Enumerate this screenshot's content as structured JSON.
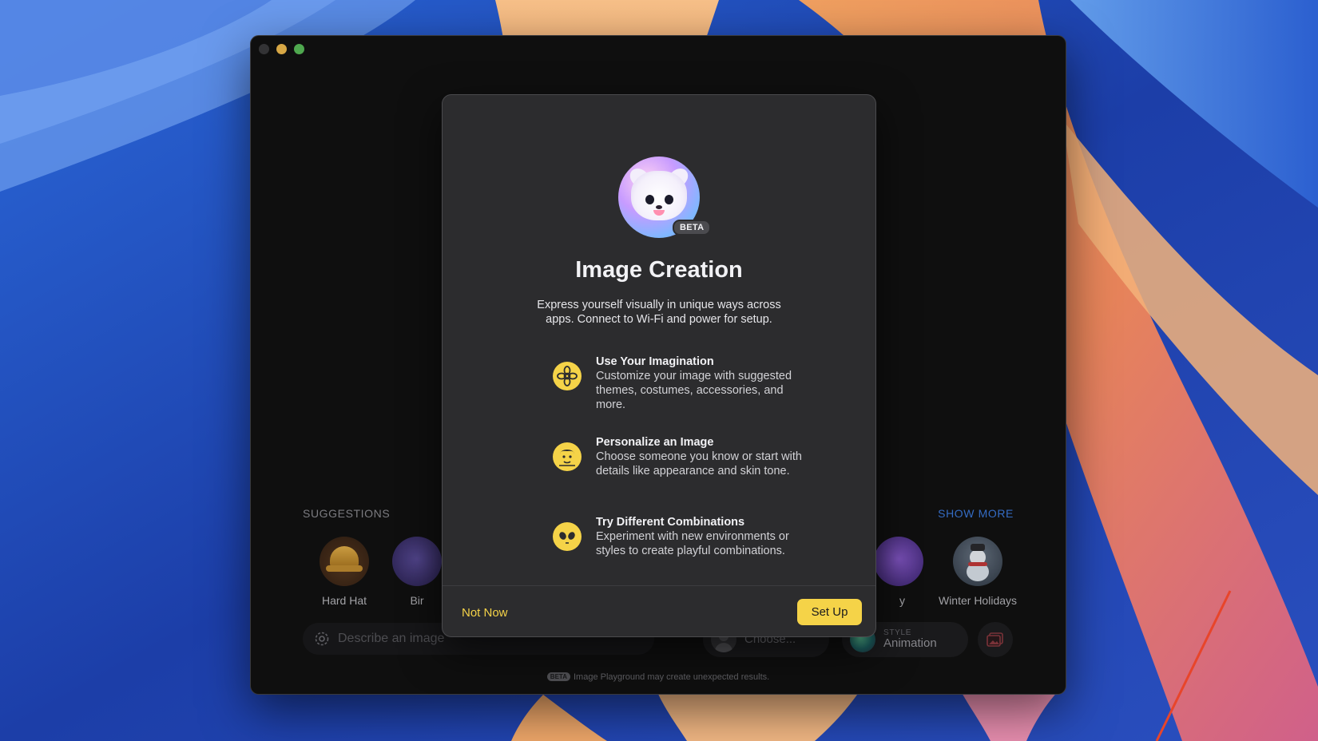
{
  "window": {
    "traffic_lights": [
      "close",
      "minimize",
      "maximize"
    ]
  },
  "suggestions": {
    "label": "SUGGESTIONS",
    "show_more": "SHOW MORE",
    "items": [
      {
        "label": "Hard Hat",
        "icon": "hard-hat"
      },
      {
        "label": "Bir",
        "icon": "bird"
      },
      {
        "label": "y",
        "icon": "party"
      },
      {
        "label": "Winter Holidays",
        "icon": "snowman"
      }
    ]
  },
  "prompt": {
    "placeholder": "Describe an image"
  },
  "person_chip": {
    "label": "Choose..."
  },
  "style_chip": {
    "caption": "STYLE",
    "label": "Animation"
  },
  "footer": {
    "badge": "BETA",
    "text": "Image Playground may create unexpected results."
  },
  "dialog": {
    "badge": "BETA",
    "title": "Image Creation",
    "subtitle": "Express yourself visually in unique ways across apps. Connect to Wi-Fi and power for setup.",
    "features": [
      {
        "title": "Use Your Imagination",
        "description": "Customize your image with suggested themes, costumes, accessories, and more.",
        "icon": "flower-icon"
      },
      {
        "title": "Personalize an Image",
        "description": "Choose someone you know or start with details like appearance and skin tone.",
        "icon": "person-face-icon"
      },
      {
        "title": "Try Different Combinations",
        "description": "Experiment with new environments or styles to create playful combinations.",
        "icon": "alien-icon"
      }
    ],
    "not_now": "Not Now",
    "set_up": "Set Up",
    "accent": "#f5d348"
  }
}
